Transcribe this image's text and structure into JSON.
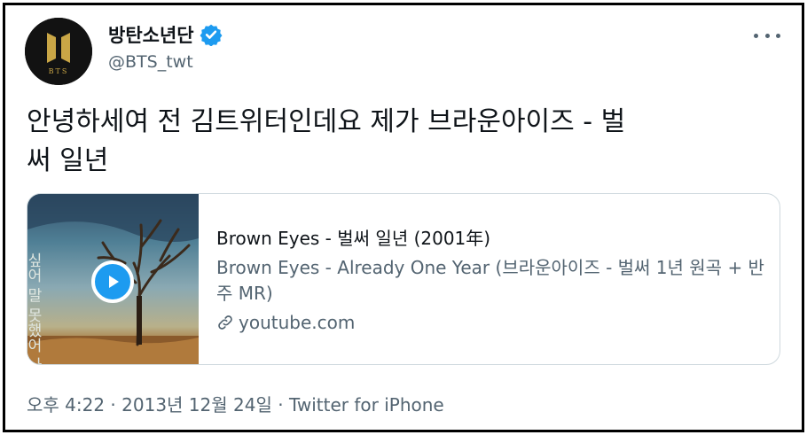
{
  "tweet": {
    "display_name": "방탄소년단",
    "handle": "@BTS_twt",
    "avatar_text": "BTS",
    "text_line1": "안녕하세여 전 김트위터인데요 제가 브라운아이즈 - 벌",
    "text_line2": "써 일년",
    "card": {
      "title": "Brown Eyes - 벌써 일년 (2001年)",
      "description": "Brown Eyes - Already One Year (브라운아이즈 - 벌써 1년 원곡 + 반주 MR)",
      "domain": "youtube.com",
      "thumb_text": "싶어 말 못했어 나뜻한 나"
    },
    "time": "오후 4:22",
    "separator1": " · ",
    "date": "2013년 12월 24일",
    "separator2": " · ",
    "source": "Twitter for iPhone"
  },
  "colors": {
    "accent": "#1d9bf0",
    "text": "#0f1419",
    "secondary": "#536471",
    "border": "#cfd9de"
  }
}
